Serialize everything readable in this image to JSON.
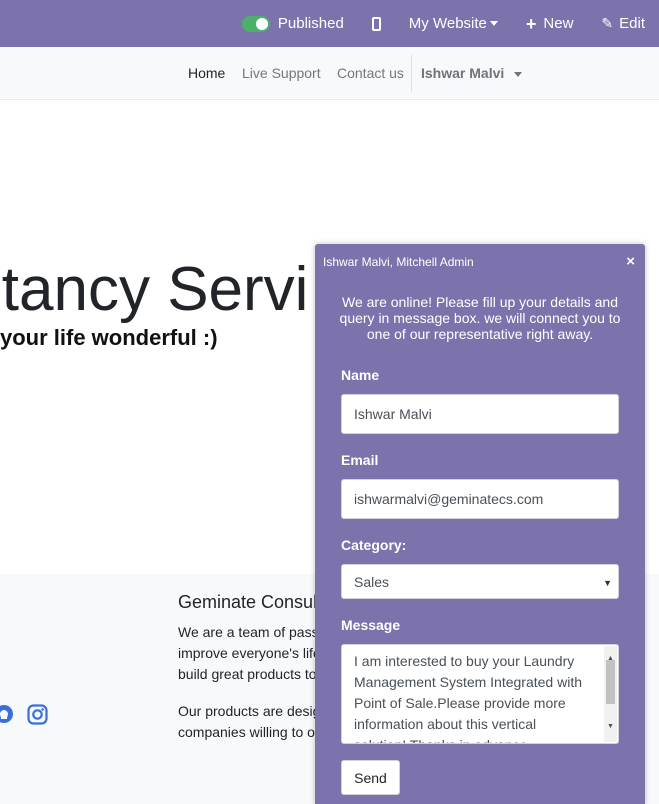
{
  "admin_bar": {
    "published_label": "Published",
    "website_label": "My Website",
    "new_label": "New",
    "edit_label": "Edit"
  },
  "nav": {
    "items": [
      "Home",
      "Live Support",
      "Contact us"
    ],
    "user": "Ishwar Malvi"
  },
  "hero": {
    "title": "ltancy Servi",
    "subtitle": "your life wonderful :)"
  },
  "footer": {
    "title": "Geminate Consult",
    "lines": [
      "We are a team of pass",
      "improve everyone's life",
      "build great products to",
      "Our products are desig",
      "companies willing to o"
    ]
  },
  "chat": {
    "header": "Ishwar Malvi, Mitchell Admin",
    "close_glyph": "×",
    "intro": "We are online! Please fill up your details and query in message box. we will connect you to one of our representative right away.",
    "name_label": "Name",
    "name_value": "Ishwar Malvi",
    "email_label": "Email",
    "email_value": "ishwarmalvi@geminatecs.com",
    "category_label": "Category:",
    "category_value": "Sales",
    "message_label": "Message",
    "message_value": "I am interested to buy your Laundry Management System Integrated with Point of Sale.Please provide more information about this vertical solution! Thanks in advance.",
    "send_label": "Send"
  },
  "colors": {
    "brand_purple": "#7c73ad",
    "toggle_green": "#4caf6a",
    "social_blue": "#3a6fd8"
  },
  "icons": [
    "toggle-icon",
    "mobile-icon",
    "plus-icon",
    "pencil-icon",
    "close-icon",
    "github-icon",
    "instagram-icon"
  ]
}
